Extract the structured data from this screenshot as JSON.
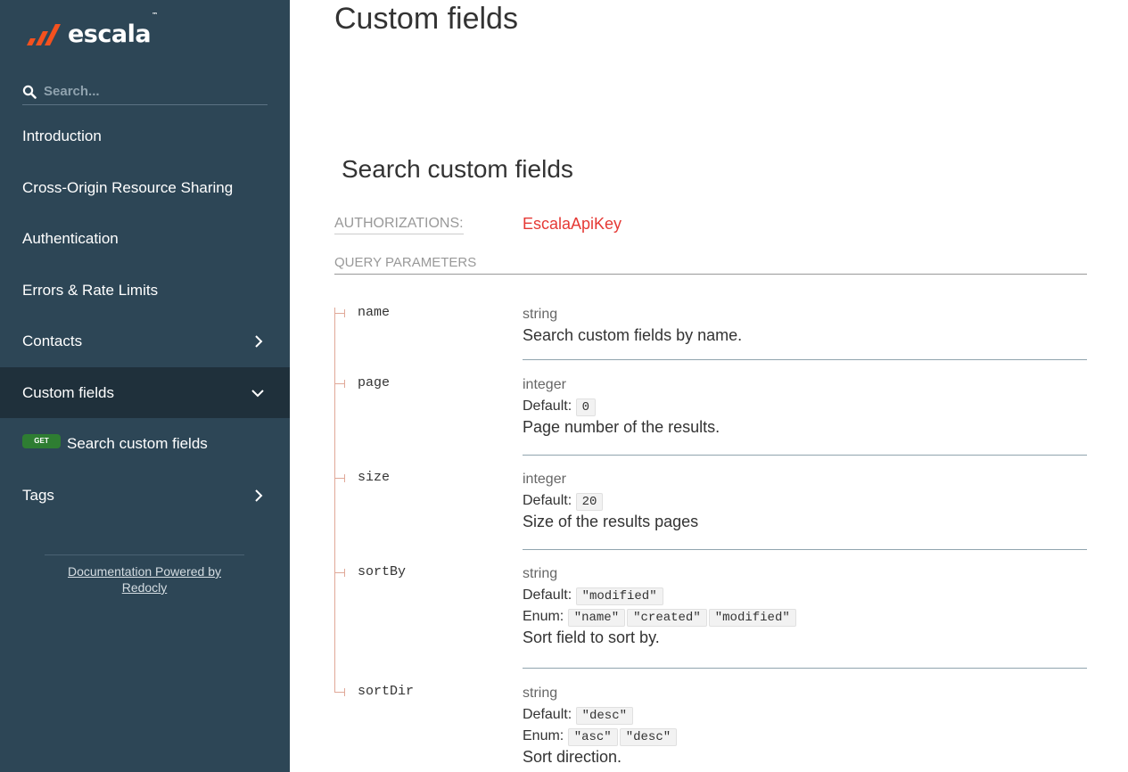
{
  "brand": {
    "name": "escala",
    "tm": "™"
  },
  "search": {
    "placeholder": "Search..."
  },
  "sidebar": {
    "items": [
      {
        "label": "Introduction"
      },
      {
        "label": "Cross-Origin Resource Sharing"
      },
      {
        "label": "Authentication"
      },
      {
        "label": "Errors & Rate Limits"
      },
      {
        "label": "Contacts",
        "icon": "chevron-right-icon"
      },
      {
        "label": "Custom fields",
        "icon": "chevron-down-icon",
        "active": true
      },
      {
        "label": "Search custom fields",
        "badge": "GET"
      },
      {
        "label": "Tags",
        "icon": "chevron-right-icon"
      }
    ],
    "powered": "Documentation Powered by Redocly"
  },
  "main": {
    "title": "Custom fields",
    "operation": {
      "title": "Search custom fields",
      "auth_label": "AUTHORIZATIONS:",
      "auth_value": "EscalaApiKey",
      "query_label": "QUERY PARAMETERS",
      "params": [
        {
          "name": "name",
          "type": "string",
          "description": "Search custom fields by name."
        },
        {
          "name": "page",
          "type": "integer",
          "default_label": "Default:",
          "default": "0",
          "description": "Page number of the results."
        },
        {
          "name": "size",
          "type": "integer",
          "default_label": "Default:",
          "default": "20",
          "description": "Size of the results pages"
        },
        {
          "name": "sortBy",
          "type": "string",
          "default_label": "Default:",
          "default": "\"modified\"",
          "enum_label": "Enum:",
          "enum": [
            "\"name\"",
            "\"created\"",
            "\"modified\""
          ],
          "description": "Sort field to sort by."
        },
        {
          "name": "sortDir",
          "type": "string",
          "default_label": "Default:",
          "default": "\"desc\"",
          "enum_label": "Enum:",
          "enum": [
            "\"asc\"",
            "\"desc\""
          ],
          "description": "Sort direction."
        }
      ]
    }
  },
  "colors": {
    "sidebar_bg": "#2d4656",
    "active_bg": "#1f303b",
    "auth_accent": "#e53935",
    "get_badge": "#2e7d32",
    "logo_accent": "#f4511e"
  }
}
